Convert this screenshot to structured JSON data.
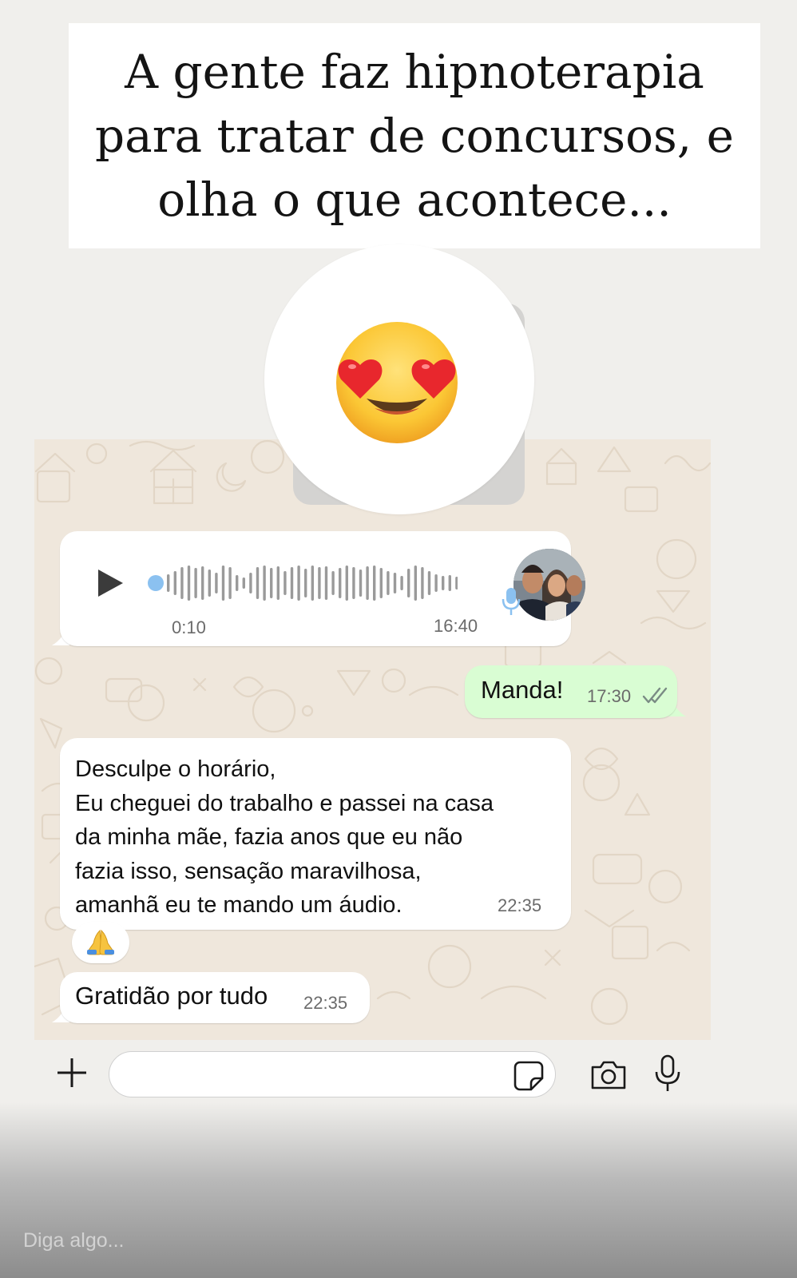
{
  "story": {
    "headline": "A gente faz hipnoterapia\npara tratar de concursos, e\nolha o que acontece...",
    "reaction_emoji": "heart-eyes-emoji",
    "reply_placeholder": "Diga algo..."
  },
  "chat": {
    "messages": [
      {
        "type": "audio",
        "direction": "incoming",
        "duration": "0:10",
        "time": "16:40"
      },
      {
        "type": "text",
        "direction": "outgoing",
        "text": "Manda!",
        "time": "17:30",
        "status": "read"
      },
      {
        "type": "text",
        "direction": "incoming",
        "text": "Desculpe o horário,\nEu cheguei do trabalho e passei na casa\nda minha mãe, fazia anos que eu não\nfazia isso, sensação maravilhosa,\namanhã eu te mando um áudio.",
        "time": "22:35",
        "reaction": "🙏"
      },
      {
        "type": "text",
        "direction": "incoming",
        "text": "Gratidão por tudo",
        "time": "22:35"
      }
    ]
  },
  "input_bar": {
    "icons": [
      "plus-icon",
      "sticker-icon",
      "camera-icon",
      "mic-icon"
    ]
  },
  "colors": {
    "chat_background": "#efe7dc",
    "incoming_bubble": "#ffffff",
    "outgoing_bubble": "#d9fdd3",
    "audio_accent": "#8bc1f0",
    "read_ticks": "#53bdeb"
  }
}
